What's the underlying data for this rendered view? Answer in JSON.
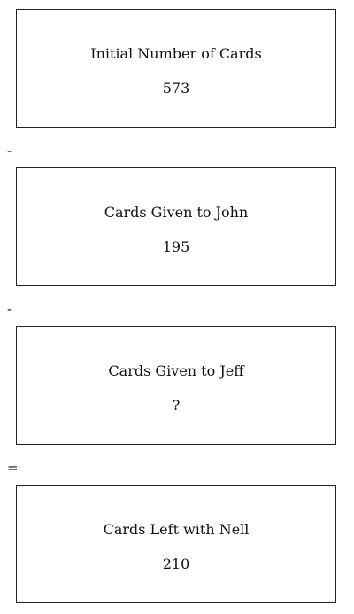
{
  "boxes": [
    {
      "label": "Initial Number of Cards",
      "value": "573"
    },
    {
      "label": "Cards Given to John",
      "value": "195"
    },
    {
      "label": "Cards Given to Jeff",
      "value": "?"
    },
    {
      "label": "Cards Left with Nell",
      "value": "210"
    }
  ],
  "operators": [
    "-",
    "-",
    "="
  ]
}
